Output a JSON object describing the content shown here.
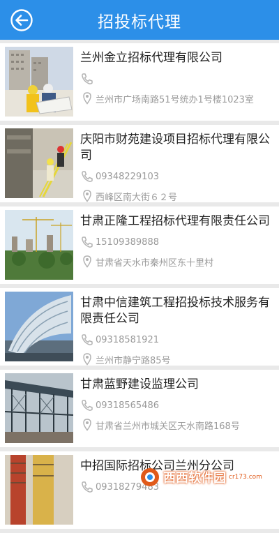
{
  "header": {
    "title": "招投标代理"
  },
  "companies": [
    {
      "name": "兰州金立招标代理有限公司",
      "phone": "",
      "address": "兰州市广场南路51号统办1号楼1023室"
    },
    {
      "name": "庆阳市财苑建设项目招标代理有限公司",
      "phone": "09348229103",
      "address": "西峰区南大街６２号"
    },
    {
      "name": "甘肃正隆工程招标代理有限责任公司",
      "phone": "15109389888",
      "address": "甘肃省天水市秦州区东十里村"
    },
    {
      "name": "甘肃中信建筑工程招投标技术服务有限责任公司",
      "phone": "09318581921",
      "address": "兰州市静宁路85号"
    },
    {
      "name": "甘肃蓝野建设监理公司",
      "phone": "09318565486",
      "address": "甘肃省兰州市城关区天水南路168号"
    },
    {
      "name": "中招国际招标公司兰州分公司",
      "phone": "09318279483",
      "address": ""
    }
  ],
  "watermark": {
    "text": "西西软件园",
    "sub": "cr173.com"
  },
  "colors": {
    "header": "#2c8fe8",
    "background": "#e9e9e9"
  }
}
